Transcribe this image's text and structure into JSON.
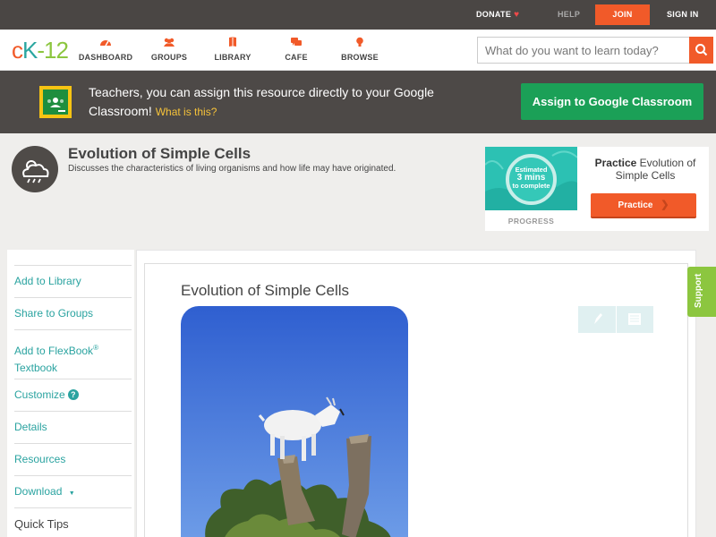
{
  "topbar": {
    "donate": "DONATE",
    "help": "HELP",
    "join": "JOIN",
    "sign_in": "SIGN IN"
  },
  "logo": {
    "c": "c",
    "k": "K",
    "n": "-12"
  },
  "nav": [
    {
      "label": "DASHBOARD",
      "icon": "dashboard-icon"
    },
    {
      "label": "GROUPS",
      "icon": "groups-icon"
    },
    {
      "label": "LIBRARY",
      "icon": "library-icon"
    },
    {
      "label": "CAFE",
      "icon": "cafe-icon"
    },
    {
      "label": "BROWSE",
      "icon": "browse-icon"
    }
  ],
  "search": {
    "placeholder": "What do you want to learn today?"
  },
  "classroom": {
    "message": "Teachers, you can assign this resource directly to your Google Classroom!",
    "what_link": "What is this?",
    "button": "Assign to Google Classroom"
  },
  "header": {
    "title": "Evolution of Simple Cells",
    "subtitle": "Discusses the characteristics of living organisms and how life may have originated."
  },
  "practice": {
    "estimated": "Estimated",
    "mins": "3 mins",
    "to_complete": "to complete",
    "progress": "PROGRESS",
    "title_bold": "Practice",
    "title_rest": "Evolution of Simple Cells",
    "button": "Practice"
  },
  "sidebar": {
    "add_library": "Add to Library",
    "share_groups": "Share to Groups",
    "add_flexbook_1": "Add to FlexBook",
    "add_flexbook_reg": "®",
    "add_flexbook_2": "Textbook",
    "customize": "Customize",
    "details": "Details",
    "resources": "Resources",
    "download": "Download",
    "download_arrow": "▼",
    "quick_tips": "Quick Tips"
  },
  "content": {
    "heading": "Evolution of Simple Cells"
  },
  "support": "Support",
  "colors": {
    "brand_orange": "#f15a29",
    "teal": "#2aa3a0",
    "green": "#8cc63f",
    "classroom_green": "#1ba057"
  }
}
